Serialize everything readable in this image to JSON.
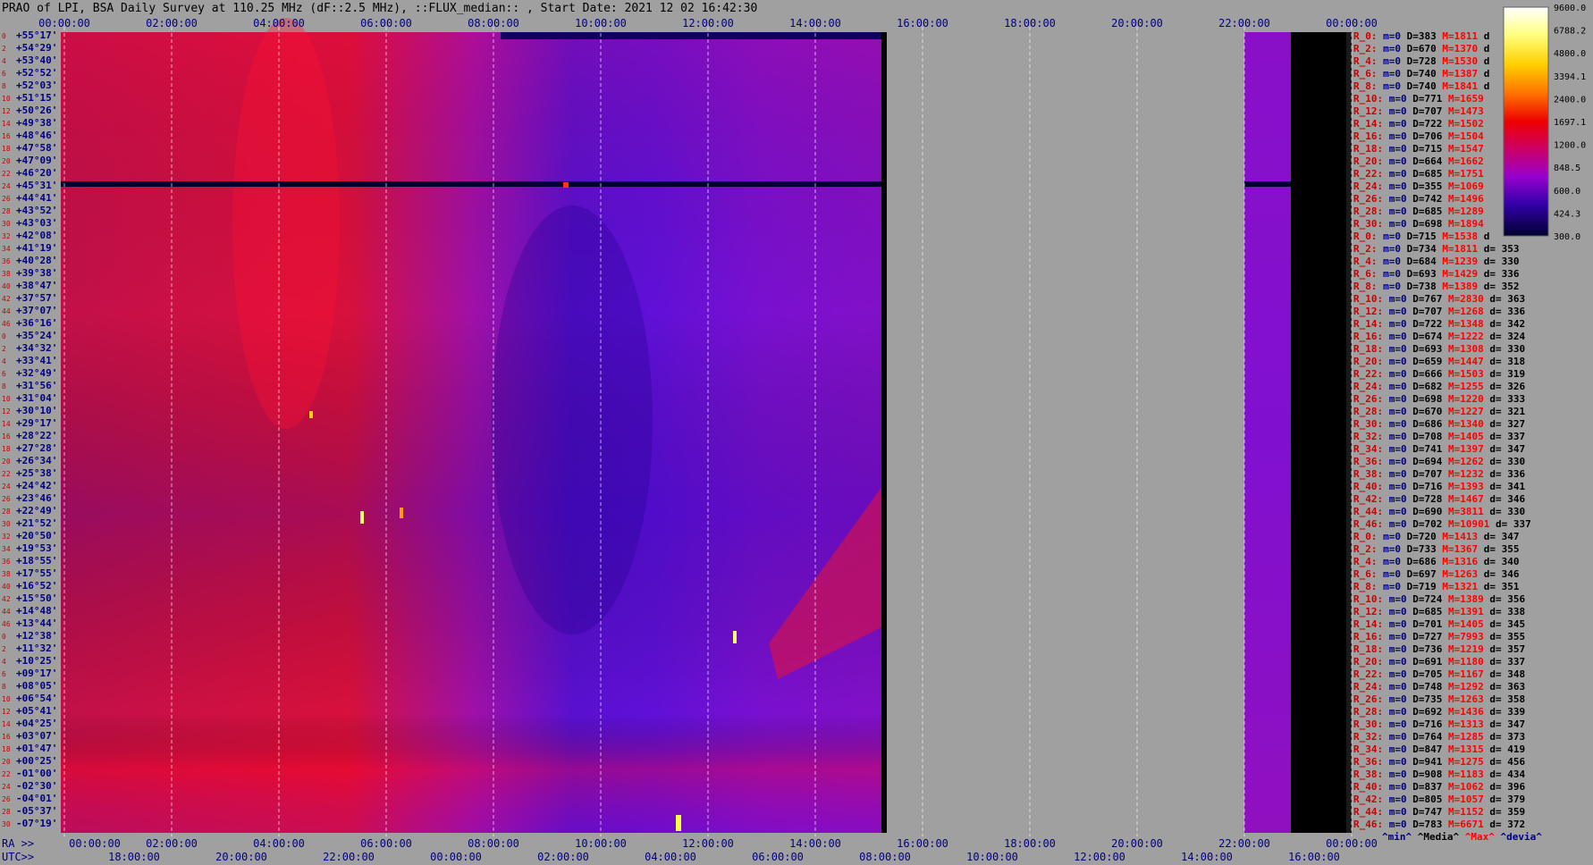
{
  "title": "PRAO of LPI, BSA Daily Survey at 110.25 MHz (dF::2.5 MHz), ::FLUX_median:: , Start Date: 2021 12 02 16:42:30",
  "chart_data": {
    "type": "heatmap",
    "title": "PRAO of LPI, BSA Daily Survey at 110.25 MHz (dF::2.5 MHz), ::FLUX_median:: , Start Date: 2021 12 02 16:42:30",
    "top_time_ticks": [
      "00:00:00",
      "02:00:00",
      "04:00:00",
      "06:00:00",
      "08:00:00",
      "10:00:00",
      "12:00:00",
      "14:00:00",
      "16:00:00",
      "18:00:00",
      "20:00:00",
      "22:00:00",
      "00:00:00"
    ],
    "ra_prefix": "RA >>",
    "ra_ticks": [
      "00:00:00",
      "02:00:00",
      "04:00:00",
      "06:00:00",
      "08:00:00",
      "10:00:00",
      "12:00:00",
      "14:00:00",
      "16:00:00",
      "18:00:00",
      "20:00:00",
      "22:00:00",
      "00:00:00"
    ],
    "utc_prefix": "UTC>>",
    "utc_ticks": [
      "18:00:00",
      "20:00:00",
      "22:00:00",
      "00:00:00",
      "02:00:00",
      "04:00:00",
      "06:00:00",
      "08:00:00",
      "10:00:00",
      "12:00:00",
      "14:00:00",
      "16:00:00"
    ],
    "dec_labels": [
      "+55°17'",
      "+54°29'",
      "+53°40'",
      "+52°52'",
      "+52°03'",
      "+51°15'",
      "+50°26'",
      "+49°38'",
      "+48°46'",
      "+47°58'",
      "+47°09'",
      "+46°20'",
      "+45°31'",
      "+44°41'",
      "+43°52'",
      "+43°03'",
      "+42°08'",
      "+41°19'",
      "+40°28'",
      "+39°38'",
      "+38°47'",
      "+37°57'",
      "+37°07'",
      "+36°16'",
      "+35°24'",
      "+34°32'",
      "+33°41'",
      "+32°49'",
      "+31°56'",
      "+31°04'",
      "+30°10'",
      "+29°17'",
      "+28°22'",
      "+27°28'",
      "+26°34'",
      "+25°38'",
      "+24°42'",
      "+23°46'",
      "+22°49'",
      "+21°52'",
      "+20°50'",
      "+19°53'",
      "+18°55'",
      "+17°55'",
      "+16°52'",
      "+15°50'",
      "+14°48'",
      "+13°44'",
      "+12°38'",
      "+11°32'",
      "+10°25'",
      "+09°17'",
      "+08°05'",
      "+06°54'",
      "+05°41'",
      "+04°25'",
      "+03°07'",
      "+01°47'",
      "+00°25'",
      "-01°00'",
      "-02°30'",
      "-04°01'",
      "-05°37'",
      "-07°19'"
    ],
    "colorbar": {
      "ticks": [
        "9600.0",
        "6788.2",
        "4800.0",
        "3394.1",
        "2400.0",
        "1697.1",
        "1200.0",
        "848.5",
        "600.0",
        "424.3",
        "300.0"
      ],
      "range": [
        300,
        9600
      ],
      "scale": "log"
    },
    "stats_rows": [
      {
        "name": "R_0:",
        "min": "m=0",
        "med": "D=383",
        "max": "M=1811",
        "dev": "d"
      },
      {
        "name": "R_2:",
        "min": "m=0",
        "med": "D=670",
        "max": "M=1370",
        "dev": "d"
      },
      {
        "name": "R_4:",
        "min": "m=0",
        "med": "D=728",
        "max": "M=1530",
        "dev": "d"
      },
      {
        "name": "R_6:",
        "min": "m=0",
        "med": "D=740",
        "max": "M=1387",
        "dev": "d"
      },
      {
        "name": "R_8:",
        "min": "m=0",
        "med": "D=740",
        "max": "M=1841",
        "dev": "d"
      },
      {
        "name": "R_10:",
        "min": "m=0",
        "med": "D=771",
        "max": "M=1659",
        "dev": ""
      },
      {
        "name": "R_12:",
        "min": "m=0",
        "med": "D=707",
        "max": "M=1473",
        "dev": ""
      },
      {
        "name": "R_14:",
        "min": "m=0",
        "med": "D=722",
        "max": "M=1502",
        "dev": ""
      },
      {
        "name": "R_16:",
        "min": "m=0",
        "med": "D=706",
        "max": "M=1504",
        "dev": ""
      },
      {
        "name": "R_18:",
        "min": "m=0",
        "med": "D=715",
        "max": "M=1547",
        "dev": ""
      },
      {
        "name": "R_20:",
        "min": "m=0",
        "med": "D=664",
        "max": "M=1662",
        "dev": ""
      },
      {
        "name": "R_22:",
        "min": "m=0",
        "med": "D=685",
        "max": "M=1751",
        "dev": ""
      },
      {
        "name": "R_24:",
        "min": "m=0",
        "med": "D=355",
        "max": "M=1069",
        "dev": ""
      },
      {
        "name": "R_26:",
        "min": "m=0",
        "med": "D=742",
        "max": "M=1496",
        "dev": ""
      },
      {
        "name": "R_28:",
        "min": "m=0",
        "med": "D=685",
        "max": "M=1289",
        "dev": ""
      },
      {
        "name": "R_30:",
        "min": "m=0",
        "med": "D=698",
        "max": "M=1894",
        "dev": ""
      },
      {
        "name": "R_0:",
        "min": "m=0",
        "med": "D=715",
        "max": "M=1538",
        "dev": "d"
      },
      {
        "name": "R_2:",
        "min": "m=0",
        "med": "D=734",
        "max": "M=1811",
        "dev": "d= 353"
      },
      {
        "name": "R_4:",
        "min": "m=0",
        "med": "D=684",
        "max": "M=1239",
        "dev": "d= 330"
      },
      {
        "name": "R_6:",
        "min": "m=0",
        "med": "D=693",
        "max": "M=1429",
        "dev": "d= 336"
      },
      {
        "name": "R_8:",
        "min": "m=0",
        "med": "D=738",
        "max": "M=1389",
        "dev": "d= 352"
      },
      {
        "name": "R_10:",
        "min": "m=0",
        "med": "D=767",
        "max": "M=2830",
        "dev": "d= 363"
      },
      {
        "name": "R_12:",
        "min": "m=0",
        "med": "D=707",
        "max": "M=1268",
        "dev": "d= 336"
      },
      {
        "name": "R_14:",
        "min": "m=0",
        "med": "D=722",
        "max": "M=1348",
        "dev": "d= 342"
      },
      {
        "name": "R_16:",
        "min": "m=0",
        "med": "D=674",
        "max": "M=1222",
        "dev": "d= 324"
      },
      {
        "name": "R_18:",
        "min": "m=0",
        "med": "D=693",
        "max": "M=1308",
        "dev": "d= 330"
      },
      {
        "name": "R_20:",
        "min": "m=0",
        "med": "D=659",
        "max": "M=1447",
        "dev": "d= 318"
      },
      {
        "name": "R_22:",
        "min": "m=0",
        "med": "D=666",
        "max": "M=1503",
        "dev": "d= 319"
      },
      {
        "name": "R_24:",
        "min": "m=0",
        "med": "D=682",
        "max": "M=1255",
        "dev": "d= 326"
      },
      {
        "name": "R_26:",
        "min": "m=0",
        "med": "D=698",
        "max": "M=1220",
        "dev": "d= 333"
      },
      {
        "name": "R_28:",
        "min": "m=0",
        "med": "D=670",
        "max": "M=1227",
        "dev": "d= 321"
      },
      {
        "name": "R_30:",
        "min": "m=0",
        "med": "D=686",
        "max": "M=1340",
        "dev": "d= 327"
      },
      {
        "name": "R_32:",
        "min": "m=0",
        "med": "D=708",
        "max": "M=1405",
        "dev": "d= 337"
      },
      {
        "name": "R_34:",
        "min": "m=0",
        "med": "D=741",
        "max": "M=1397",
        "dev": "d= 347"
      },
      {
        "name": "R_36:",
        "min": "m=0",
        "med": "D=694",
        "max": "M=1262",
        "dev": "d= 330"
      },
      {
        "name": "R_38:",
        "min": "m=0",
        "med": "D=707",
        "max": "M=1232",
        "dev": "d= 336"
      },
      {
        "name": "R_40:",
        "min": "m=0",
        "med": "D=716",
        "max": "M=1393",
        "dev": "d= 341"
      },
      {
        "name": "R_42:",
        "min": "m=0",
        "med": "D=728",
        "max": "M=1467",
        "dev": "d= 346"
      },
      {
        "name": "R_44:",
        "min": "m=0",
        "med": "D=690",
        "max": "M=3811",
        "dev": "d= 330"
      },
      {
        "name": "R_46:",
        "min": "m=0",
        "med": "D=702",
        "max": "M=10901",
        "dev": "d= 337"
      },
      {
        "name": "R_0:",
        "min": "m=0",
        "med": "D=720",
        "max": "M=1413",
        "dev": "d= 347"
      },
      {
        "name": "R_2:",
        "min": "m=0",
        "med": "D=733",
        "max": "M=1367",
        "dev": "d= 355"
      },
      {
        "name": "R_4:",
        "min": "m=0",
        "med": "D=686",
        "max": "M=1316",
        "dev": "d= 340"
      },
      {
        "name": "R_6:",
        "min": "m=0",
        "med": "D=697",
        "max": "M=1263",
        "dev": "d= 346"
      },
      {
        "name": "R_8:",
        "min": "m=0",
        "med": "D=719",
        "max": "M=1321",
        "dev": "d= 351"
      },
      {
        "name": "R_10:",
        "min": "m=0",
        "med": "D=724",
        "max": "M=1389",
        "dev": "d= 356"
      },
      {
        "name": "R_12:",
        "min": "m=0",
        "med": "D=685",
        "max": "M=1391",
        "dev": "d= 338"
      },
      {
        "name": "R_14:",
        "min": "m=0",
        "med": "D=701",
        "max": "M=1405",
        "dev": "d= 345"
      },
      {
        "name": "R_16:",
        "min": "m=0",
        "med": "D=727",
        "max": "M=7993",
        "dev": "d= 355"
      },
      {
        "name": "R_18:",
        "min": "m=0",
        "med": "D=736",
        "max": "M=1219",
        "dev": "d= 357"
      },
      {
        "name": "R_20:",
        "min": "m=0",
        "med": "D=691",
        "max": "M=1180",
        "dev": "d= 337"
      },
      {
        "name": "R_22:",
        "min": "m=0",
        "med": "D=705",
        "max": "M=1167",
        "dev": "d= 348"
      },
      {
        "name": "R_24:",
        "min": "m=0",
        "med": "D=748",
        "max": "M=1292",
        "dev": "d= 363"
      },
      {
        "name": "R_26:",
        "min": "m=0",
        "med": "D=735",
        "max": "M=1263",
        "dev": "d= 358"
      },
      {
        "name": "R_28:",
        "min": "m=0",
        "med": "D=692",
        "max": "M=1436",
        "dev": "d= 339"
      },
      {
        "name": "R_30:",
        "min": "m=0",
        "med": "D=716",
        "max": "M=1313",
        "dev": "d= 347"
      },
      {
        "name": "R_32:",
        "min": "m=0",
        "med": "D=764",
        "max": "M=1285",
        "dev": "d= 373"
      },
      {
        "name": "R_34:",
        "min": "m=0",
        "med": "D=847",
        "max": "M=1315",
        "dev": "d= 419"
      },
      {
        "name": "R_36:",
        "min": "m=0",
        "med": "D=941",
        "max": "M=1275",
        "dev": "d= 456"
      },
      {
        "name": "R_38:",
        "min": "m=0",
        "med": "D=908",
        "max": "M=1183",
        "dev": "d= 434"
      },
      {
        "name": "R_40:",
        "min": "m=0",
        "med": "D=837",
        "max": "M=1062",
        "dev": "d= 396"
      },
      {
        "name": "R_42:",
        "min": "m=0",
        "med": "D=805",
        "max": "M=1057",
        "dev": "d= 379"
      },
      {
        "name": "R_44:",
        "min": "m=0",
        "med": "D=747",
        "max": "M=1152",
        "dev": "d= 359"
      },
      {
        "name": "R_46:",
        "min": "m=0",
        "med": "D=783",
        "max": "M=6671",
        "dev": "d= 372"
      }
    ],
    "stats_legend": [
      "^min^",
      "^Media^",
      "^Max^",
      "^devia^"
    ],
    "colors": {
      "background": "#a0a0a0",
      "min_text": "#000080",
      "max_text": "#ff0000",
      "label_red": "#cc0000",
      "dec_text": "#000080"
    }
  }
}
